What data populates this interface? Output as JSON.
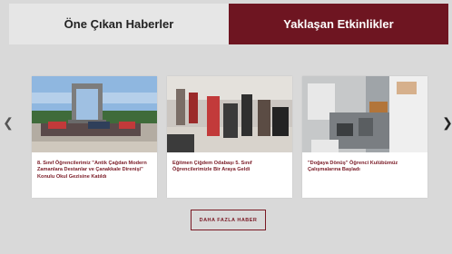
{
  "tabs": [
    {
      "label": "Öne Çıkan Haberler",
      "active": false
    },
    {
      "label": "Yaklaşan Etkinlikler",
      "active": true
    }
  ],
  "carousel": {
    "prev_icon": "chevron-left-icon",
    "next_icon": "chevron-right-icon",
    "cards": [
      {
        "title": "8. Sınıf Öğrencilerimiz \"Antik Çağdan Modern Zamanlara Destanlar ve Çanakkale Direnişi\" Konulu Okul Gezisine Katıldı"
      },
      {
        "title": "Eğitmen Çiğdem Odabaşı 5. Sınıf Öğrencilerimizle Bir Araya Geldi"
      },
      {
        "title": "\"Doğaya Dönüş\" Öğrenci Kulübümüz Çalışmalarına Başladı"
      }
    ]
  },
  "more_button": {
    "label": "DAHA FAZLA HABER"
  },
  "colors": {
    "accent": "#6e1521",
    "background": "#d9d9d9"
  }
}
